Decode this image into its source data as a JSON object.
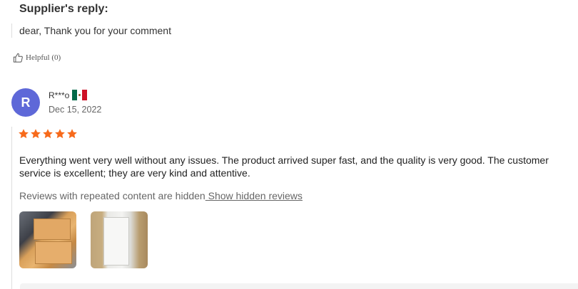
{
  "supplier_reply": {
    "title": "Supplier's reply:",
    "text": "dear, Thank you for your comment"
  },
  "helpful": {
    "label": "Helpful (0)"
  },
  "review": {
    "avatar_letter": "R",
    "reviewer_name": "R***o",
    "country_flag": "Mexico",
    "date": "Dec 15, 2022",
    "rating": 5,
    "rating_max": 5,
    "text": "Everything went very well without any issues. The product arrived super fast, and the quality is very good. The customer service is excellent; they are very kind and attentive.",
    "hidden_note": "Reviews with repeated content are hidden",
    "show_hidden_link": "Show hidden reviews"
  },
  "colors": {
    "avatar_bg": "#5e68d8",
    "star": "#f76a1b"
  }
}
